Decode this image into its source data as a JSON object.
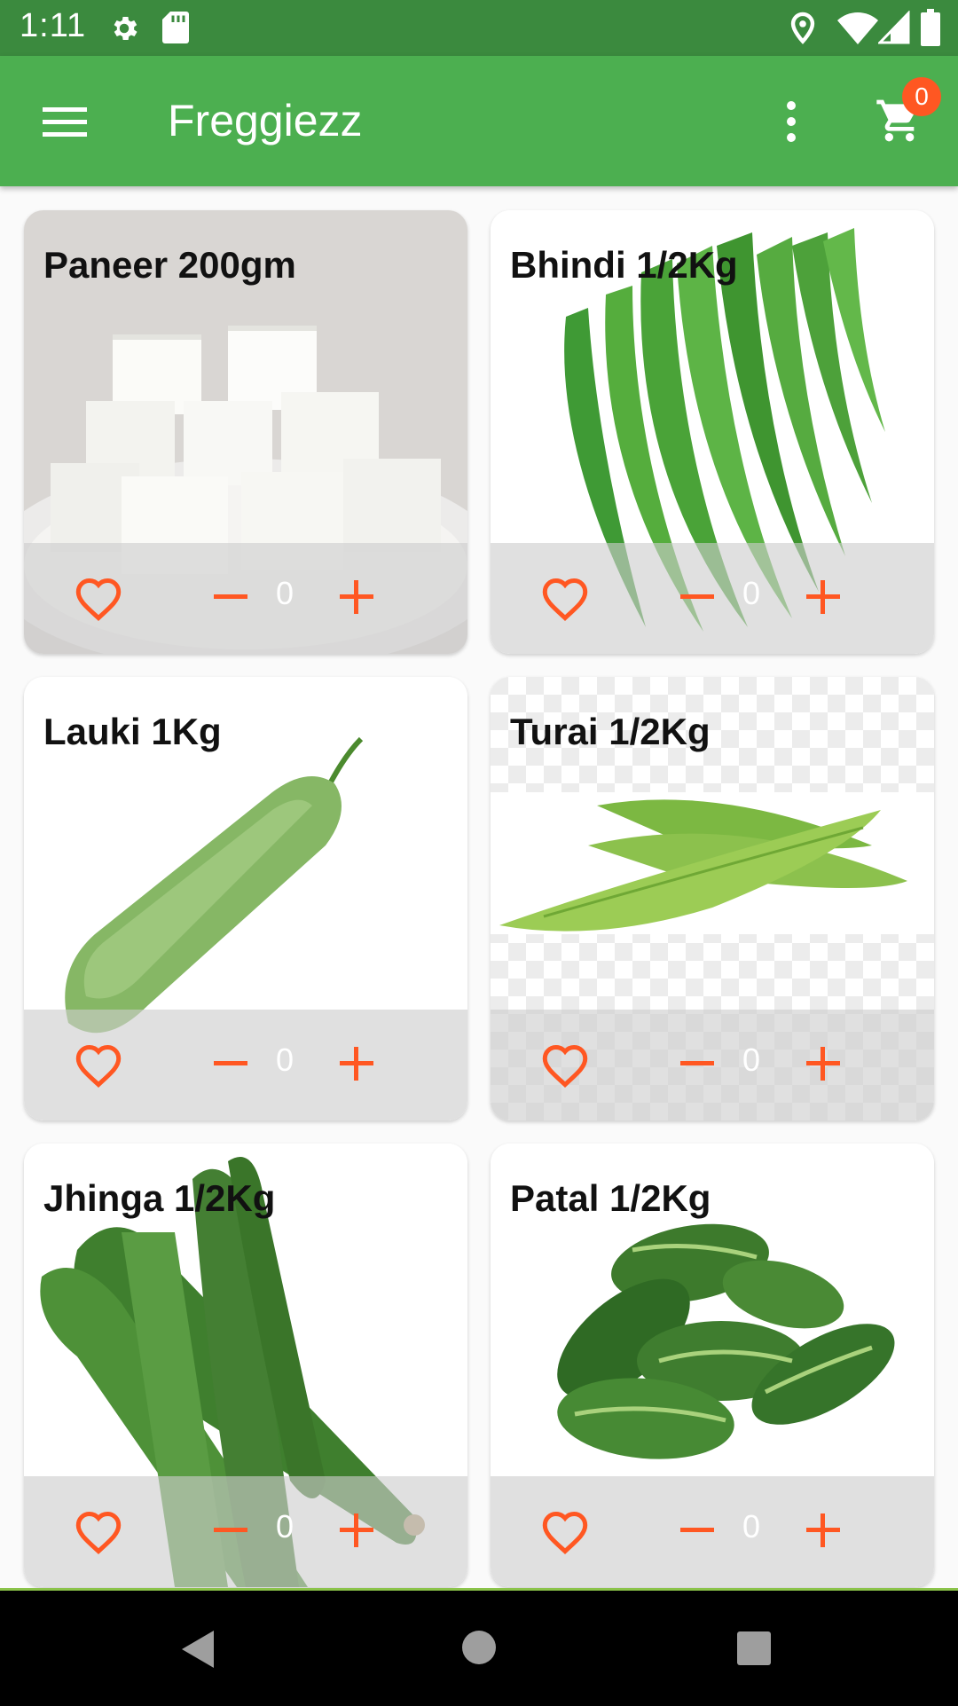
{
  "status_bar": {
    "time": "1:11",
    "icons": [
      "gear-icon",
      "sd-card-icon",
      "location-icon",
      "wifi-icon",
      "signal-icon",
      "battery-icon"
    ]
  },
  "app_bar": {
    "title": "Freggiezz",
    "menu_icon": "hamburger-menu-icon",
    "overflow_icon": "more-vertical-icon",
    "cart_icon": "shopping-cart-icon",
    "cart_count": "0"
  },
  "products": [
    {
      "name": "Paneer 200gm",
      "quantity": "0",
      "image": "paneer-cubes"
    },
    {
      "name": "Bhindi 1/2Kg",
      "quantity": "0",
      "image": "okra"
    },
    {
      "name": "Lauki 1Kg",
      "quantity": "0",
      "image": "bottle-gourd"
    },
    {
      "name": "Turai 1/2Kg",
      "quantity": "0",
      "image": "ridge-gourd"
    },
    {
      "name": "Jhinga 1/2Kg",
      "quantity": "0",
      "image": "sponge-gourd"
    },
    {
      "name": "Patal 1/2Kg",
      "quantity": "0",
      "image": "pointed-gourd"
    }
  ],
  "colors": {
    "status_bar": "#3b8a3e",
    "app_bar": "#4caf50",
    "accent": "#ff5722",
    "navigation_bar": "#000000"
  },
  "navigation_bar": {
    "icons": [
      "back-icon",
      "home-icon",
      "recents-icon"
    ]
  }
}
